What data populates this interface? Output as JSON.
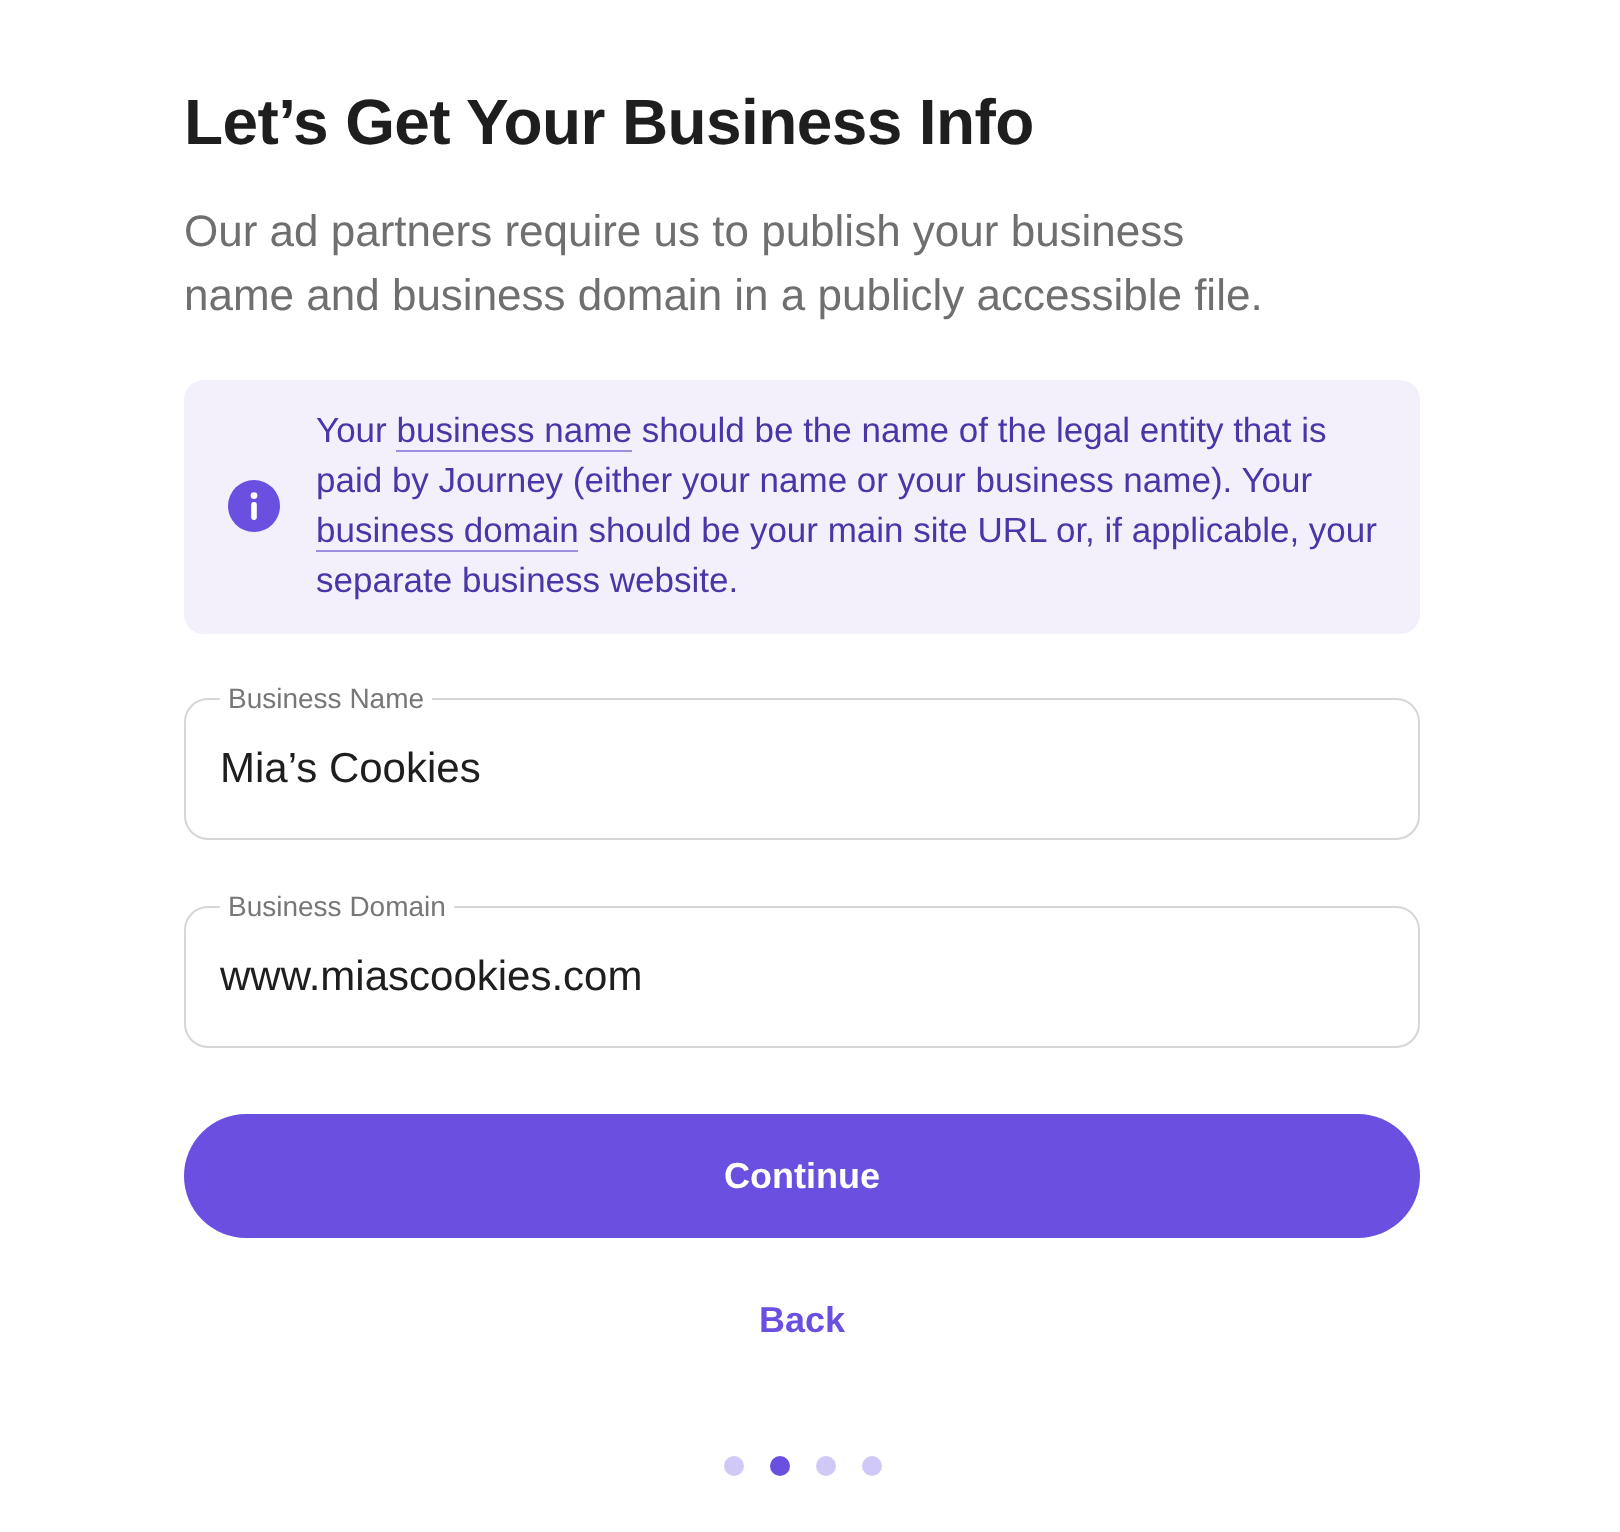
{
  "title": "Let’s Get Your Business Info",
  "subtitle": "Our ad partners require us to publish your business name and business domain in a publicly accessible file.",
  "info_note": {
    "segments": [
      {
        "text": "Your ",
        "underlined": false
      },
      {
        "text": "business name",
        "underlined": true
      },
      {
        "text": " should be the name of the legal entity that is paid by Journey (either your name or your business name). Your ",
        "underlined": false
      },
      {
        "text": "business domain",
        "underlined": true
      },
      {
        "text": " should be your main site URL or, if applicable, your separate business website.",
        "underlined": false
      }
    ]
  },
  "fields": [
    {
      "label": "Business Name",
      "value": "Mia’s Cookies"
    },
    {
      "label": "Business Domain",
      "value": "www.miascookies.com"
    }
  ],
  "primary_button": "Continue",
  "back_link": "Back",
  "steps": [
    {
      "selected": false
    },
    {
      "selected": true
    },
    {
      "selected": false
    },
    {
      "selected": false
    }
  ]
}
